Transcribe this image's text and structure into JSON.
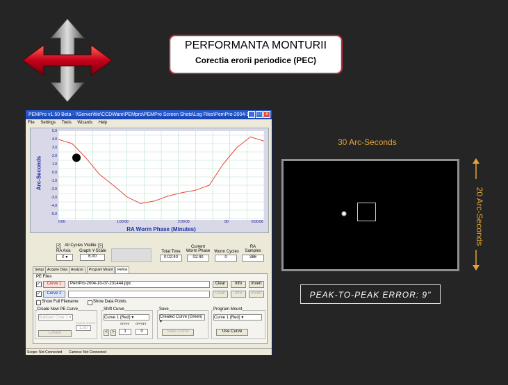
{
  "slide": {
    "title": "PERFORMANTA MONTURII",
    "subtitle": "Corectia erorii periodice (PEC)",
    "arc_30": "30 Arc-Seconds",
    "arc_20": "20 Arc-Seconds",
    "peak": "PEAK-TO-PEAK ERROR: 9\"",
    "accent": "#e0a535"
  },
  "window": {
    "title": "PEMPro v1.50 Beta - \\\\Server\\file\\CCDWare\\PEMpro\\PEMPro Screen Shots\\Log Files\\PemPro-2004-1...",
    "menu": [
      "File",
      "Settings",
      "Tools",
      "Wizards",
      "Help"
    ],
    "min": "_",
    "max": "□",
    "close": "x"
  },
  "graph": {
    "ylabel": "Arc-Seconds",
    "xlabel": "RA Worm Phase (Minutes)",
    "yticks": [
      "5.0",
      "4.0",
      "3.0",
      "2.0",
      "1.0",
      "0.0",
      "-1.0",
      "-2.0",
      "-3.0",
      "-4.0",
      "-5.0"
    ],
    "xticks": [
      "0:00",
      "1:00:00",
      "2:00:00",
      ":00",
      "6:00:00"
    ]
  },
  "controls": {
    "all_cycles": "All Cycles Visible",
    "ra_axis_label": "RA Axis",
    "ra_axis_value": "X",
    "y_scale_label": "Graph Y-Scale",
    "y_scale_value": "6.00",
    "total_time_label": "Total Time",
    "total_time": "0:02:40",
    "worm_phase_label": "Current\nWorm Phase",
    "worm_phase": "02:40",
    "worm_cycles_label": "Worm Cycles",
    "worm_cycles": "0",
    "samples_label": "RA\nSamples",
    "samples": "386"
  },
  "tabs": [
    "Setup",
    "Acquire Data",
    "Analyze",
    "Program Mount",
    "Refine"
  ],
  "pe_files": {
    "group": "PE Files",
    "curve1": "Curve 1",
    "curve1_file": "PemPro-2004-10-07-231444.ppc",
    "curve2": "Curve 2",
    "clear": "Clear",
    "info": "Info",
    "invert": "Invert",
    "show_full": "Show Full Filename",
    "show_points": "Show Data Points"
  },
  "groups": {
    "create_title": "Create New PE Curve",
    "create_select": "Subtract Crve 1",
    "scale_label": "SCALE CURVE",
    "scale_value": "1.00",
    "create_btn": "Create",
    "shift_title": "Shift Curve",
    "shift_select": "Curve 1 (Red)",
    "steps_label": "STEPS",
    "steps_value": "1",
    "offset_label": "OFFSET",
    "offset_value": "0",
    "save_title": "Save",
    "save_select": "Created Curve (Green)",
    "save_btn": "Save Curve",
    "program_title": "Program Mount",
    "program_select": "Curve 1 (Red)",
    "use_btn": "Use Curve"
  },
  "status": {
    "scope": "Scope: Not Connected",
    "camera": "Camera: Not Connected"
  },
  "chart_data": {
    "type": "line",
    "ylim": [
      -5,
      5
    ],
    "series": [
      {
        "values": [
          4.5,
          4.0,
          2.3,
          0.3,
          -1.0,
          -2.4,
          -3.2,
          -2.9,
          -2.3,
          -1.9,
          -1.6,
          -1.0,
          1.5,
          3.5,
          4.8,
          4.3
        ]
      }
    ],
    "color": "#e8443a"
  }
}
